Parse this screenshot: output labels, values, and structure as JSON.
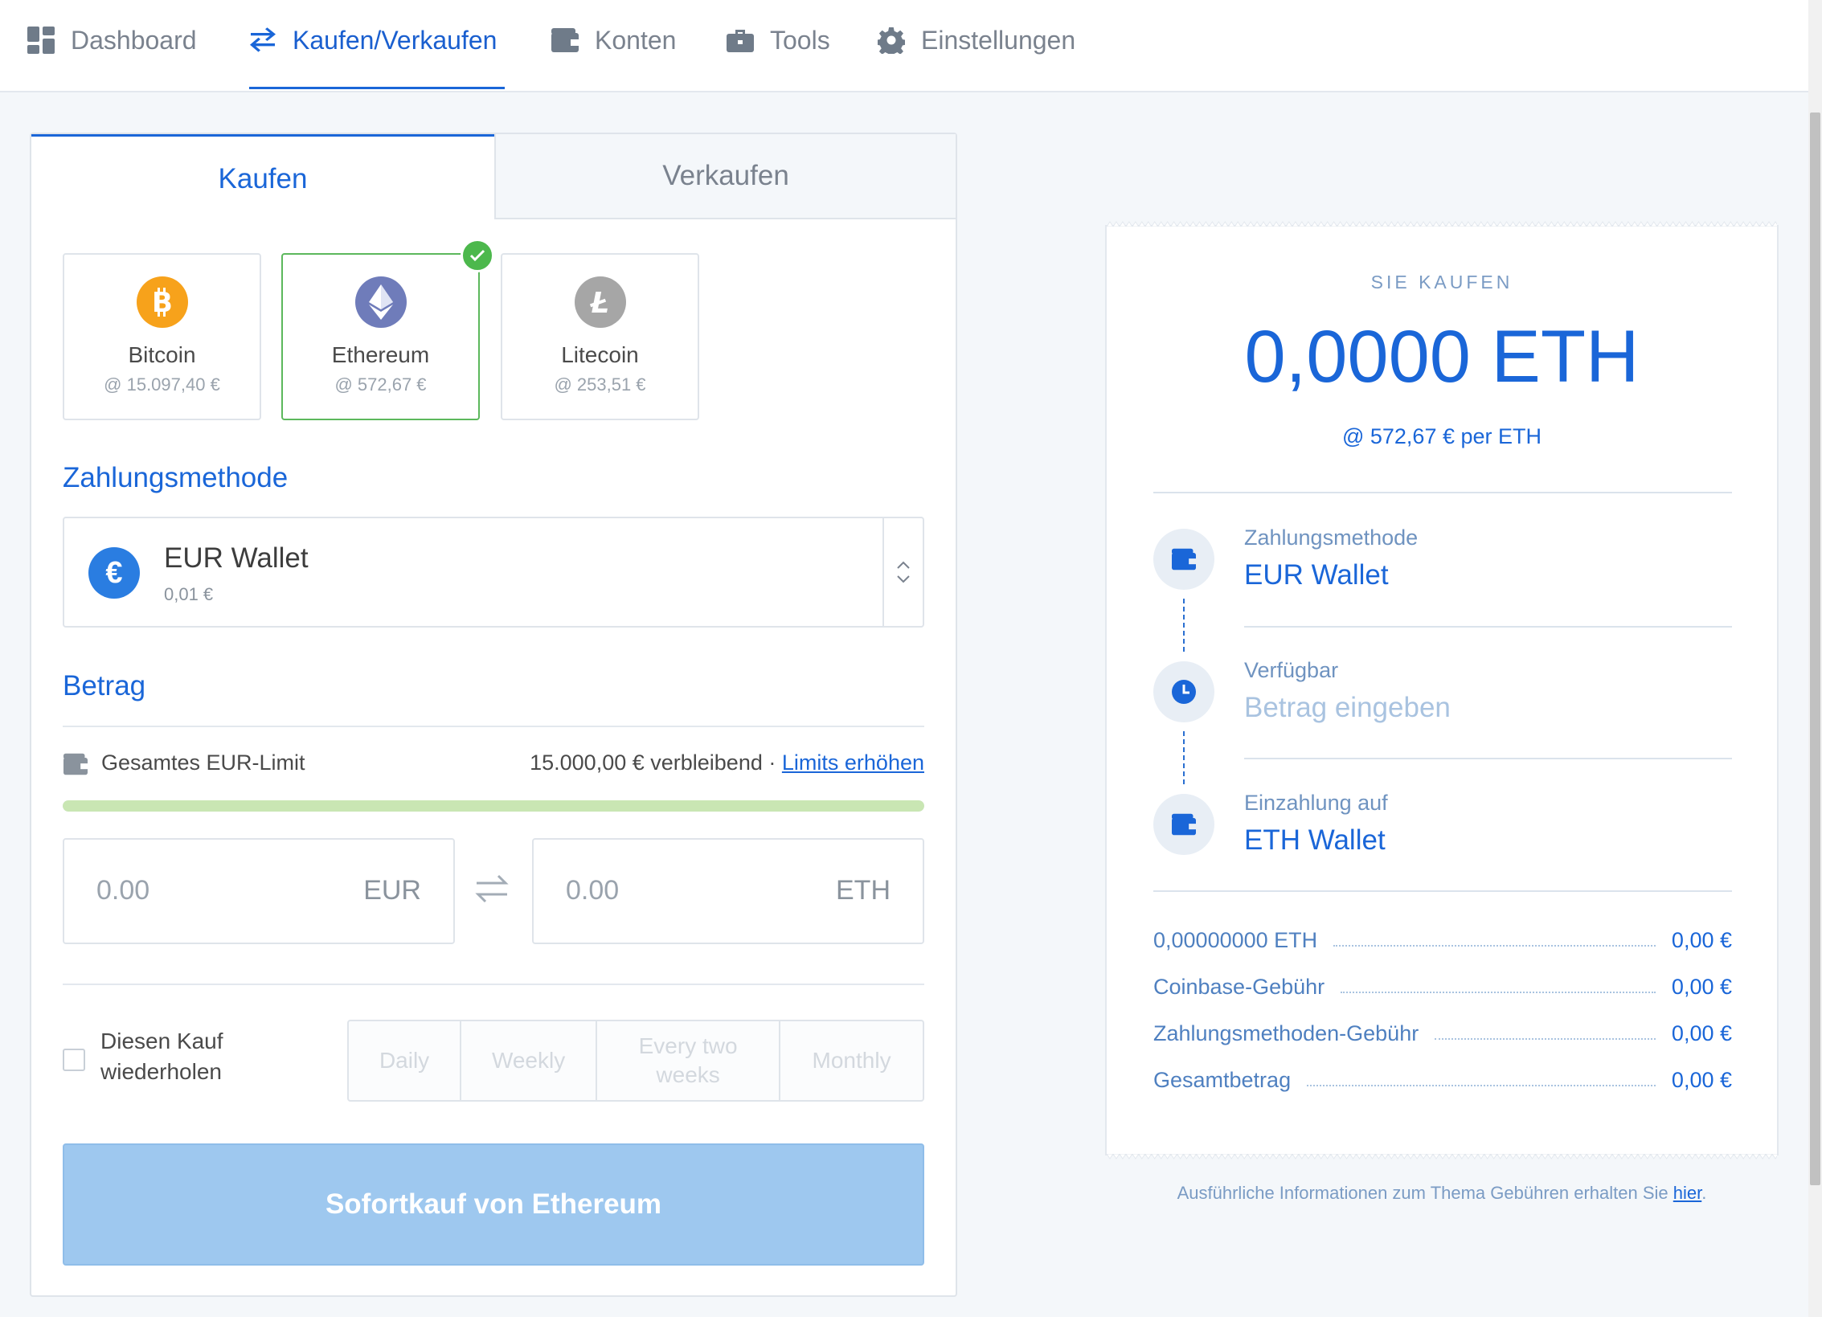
{
  "nav": {
    "items": [
      {
        "label": "Dashboard",
        "icon": "dashboard-icon"
      },
      {
        "label": "Kaufen/Verkaufen",
        "icon": "swap-arrows-icon"
      },
      {
        "label": "Konten",
        "icon": "wallet-icon"
      },
      {
        "label": "Tools",
        "icon": "briefcase-icon"
      },
      {
        "label": "Einstellungen",
        "icon": "gear-icon"
      }
    ],
    "active": "Kaufen/Verkaufen"
  },
  "tabs": {
    "buy": "Kaufen",
    "sell": "Verkaufen",
    "active": "buy"
  },
  "coins": [
    {
      "name": "Bitcoin",
      "price": "@ 15.097,40 €",
      "color": "#f7a21b",
      "selected": false
    },
    {
      "name": "Ethereum",
      "price": "@ 572,67 €",
      "color": "#6f7cba",
      "selected": true
    },
    {
      "name": "Litecoin",
      "price": "@ 253,51 €",
      "color": "#a6a6a6",
      "selected": false
    }
  ],
  "payment": {
    "title": "Zahlungsmethode",
    "method": "EUR Wallet",
    "balance": "0,01 €"
  },
  "amount": {
    "title": "Betrag",
    "limit_label": "Gesamtes EUR-Limit",
    "limit_remaining": "15.000,00 € verbleibend",
    "limit_sep": "·",
    "limit_link": "Limits erhöhen",
    "limit_progress_fraction": 1.0,
    "fiat_placeholder": "0.00",
    "fiat_currency": "EUR",
    "crypto_placeholder": "0.00",
    "crypto_currency": "ETH"
  },
  "repeat": {
    "label": "Diesen Kauf wiederholen",
    "checked": false,
    "options": [
      "Daily",
      "Weekly",
      "Every two weeks",
      "Monthly"
    ]
  },
  "buy_button": "Sofortkauf von Ethereum",
  "summary": {
    "kicker": "SIE KAUFEN",
    "amount": "0,0000 ETH",
    "rate": "@ 572,67 € per ETH",
    "steps": [
      {
        "label": "Zahlungsmethode",
        "value": "EUR Wallet",
        "icon": "wallet-icon"
      },
      {
        "label": "Verfügbar",
        "value": "Betrag eingeben",
        "icon": "clock-icon"
      },
      {
        "label": "Einzahlung auf",
        "value": "ETH Wallet",
        "icon": "wallet-icon"
      }
    ],
    "fees": [
      {
        "name": "0,00000000 ETH",
        "value": "0,00 €"
      },
      {
        "name": "Coinbase-Gebühr",
        "value": "0,00 €"
      },
      {
        "name": "Zahlungsmethoden-Gebühr",
        "value": "0,00 €"
      },
      {
        "name": "Gesamtbetrag",
        "value": "0,00 €"
      }
    ]
  },
  "footnote": {
    "text": "Ausführliche Informationen zum Thema Gebühren erhalten Sie ",
    "link": "hier",
    "end": "."
  },
  "colors": {
    "accent": "#1a66d8",
    "success": "#4cb84c",
    "button_disabled": "#9ec8ef"
  }
}
